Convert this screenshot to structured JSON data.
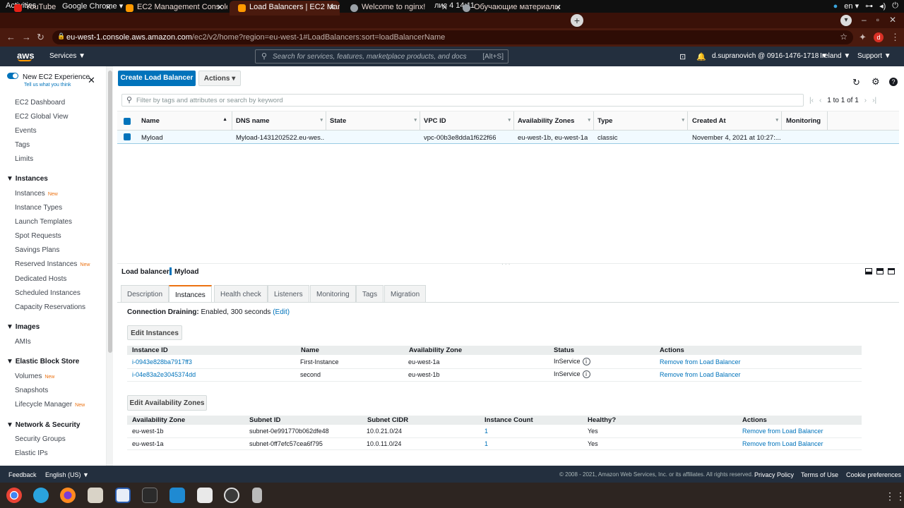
{
  "system": {
    "activities": "Activities",
    "app": "Google Chrome ▾",
    "clock": "лис 4  14:11",
    "lang": "en ▾"
  },
  "browser": {
    "tabs": [
      {
        "title": "YouTube",
        "color": "#e62117"
      },
      {
        "title": "EC2 Management Console",
        "color": "#f90"
      },
      {
        "title": "Load Balancers | EC2 Man",
        "color": "#f90"
      },
      {
        "title": "Welcome to nginx!",
        "color": "#9aa0a6"
      },
      {
        "title": "Обучающие материалы",
        "color": "#9aa0a6"
      }
    ],
    "url_host": "eu-west-1.console.aws.amazon.com",
    "url_path": "/ec2/v2/home?region=eu-west-1#LoadBalancers:sort=loadBalancerName",
    "profile": "d"
  },
  "aws": {
    "logo": "aws",
    "services": "Services ▼",
    "search_placeholder": "Search for services, features, marketplace products, and docs",
    "search_kbd": "[Alt+S]",
    "account": "d.supranovich @ 0916-1476-1718 ▼",
    "region": "Ireland ▼",
    "support": "Support ▼"
  },
  "sidebar": {
    "toggle_label": "New EC2 Experience",
    "feedback_link": "Tell us what you think",
    "top": [
      "EC2 Dashboard",
      "EC2 Global View",
      "Events",
      "Tags",
      "Limits"
    ],
    "instances_title": "Instances",
    "instances": [
      "Instances",
      "Instance Types",
      "Launch Templates",
      "Spot Requests",
      "Savings Plans",
      "Reserved Instances",
      "Dedicated Hosts",
      "Scheduled Instances",
      "Capacity Reservations"
    ],
    "images_title": "Images",
    "images": [
      "AMIs"
    ],
    "ebs_title": "Elastic Block Store",
    "ebs": [
      "Volumes",
      "Snapshots",
      "Lifecycle Manager"
    ],
    "net_title": "Network & Security",
    "net": [
      "Security Groups",
      "Elastic IPs"
    ],
    "new_badge": "New"
  },
  "toolbar": {
    "create": "Create Load Balancer",
    "actions": "Actions ▾",
    "filter_placeholder": "Filter by tags and attributes or search by keyword",
    "pagination": "1 to 1 of 1"
  },
  "grid": {
    "columns": [
      "Name",
      "DNS name",
      "State",
      "VPC ID",
      "Availability Zones",
      "Type",
      "Created At",
      "Monitoring"
    ],
    "rows": [
      {
        "name": "Myload",
        "dns": "Myload-1431202522.eu-wes...",
        "state": "",
        "vpc": "vpc-00b3e8dda1f622f66",
        "az": "eu-west-1b, eu-west-1a",
        "type": "classic",
        "created": "November 4, 2021 at 10:27:...",
        "monitoring": ""
      }
    ]
  },
  "detail": {
    "label": "Load balancer:",
    "name": "Myload",
    "tabs": [
      "Description",
      "Instances",
      "Health check",
      "Listeners",
      "Monitoring",
      "Tags",
      "Migration"
    ],
    "draining_label": "Connection Draining:",
    "draining_value": "Enabled, 300 seconds",
    "edit": "(Edit)",
    "edit_instances": "Edit Instances",
    "inst_cols": [
      "Instance ID",
      "Name",
      "Availability Zone",
      "Status",
      "Actions"
    ],
    "instances": [
      {
        "id": "i-0943e828ba7917ff3",
        "name": "First-Instance",
        "az": "eu-west-1a",
        "status": "InService",
        "action": "Remove from Load Balancer"
      },
      {
        "id": "i-04e83a2e3045374dd",
        "name": "second",
        "az": "eu-west-1b",
        "status": "InService",
        "action": "Remove from Load Balancer"
      }
    ],
    "edit_az": "Edit Availability Zones",
    "az_cols": [
      "Availability Zone",
      "Subnet ID",
      "Subnet CIDR",
      "Instance Count",
      "Healthy?",
      "Actions"
    ],
    "azs": [
      {
        "az": "eu-west-1b",
        "subnet": "subnet-0e991770b062dfe48",
        "cidr": "10.0.21.0/24",
        "count": "1",
        "healthy": "Yes",
        "action": "Remove from Load Balancer"
      },
      {
        "az": "eu-west-1a",
        "subnet": "subnet-0ff7efc57cea6f795",
        "cidr": "10.0.11.0/24",
        "count": "1",
        "healthy": "Yes",
        "action": "Remove from Load Balancer"
      }
    ]
  },
  "footer": {
    "feedback": "Feedback",
    "language": "English (US) ▼",
    "copyright": "© 2008 - 2021, Amazon Web Services, Inc. or its affiliates. All rights reserved.",
    "privacy": "Privacy Policy",
    "terms": "Terms of Use",
    "cookies": "Cookie preferences"
  }
}
